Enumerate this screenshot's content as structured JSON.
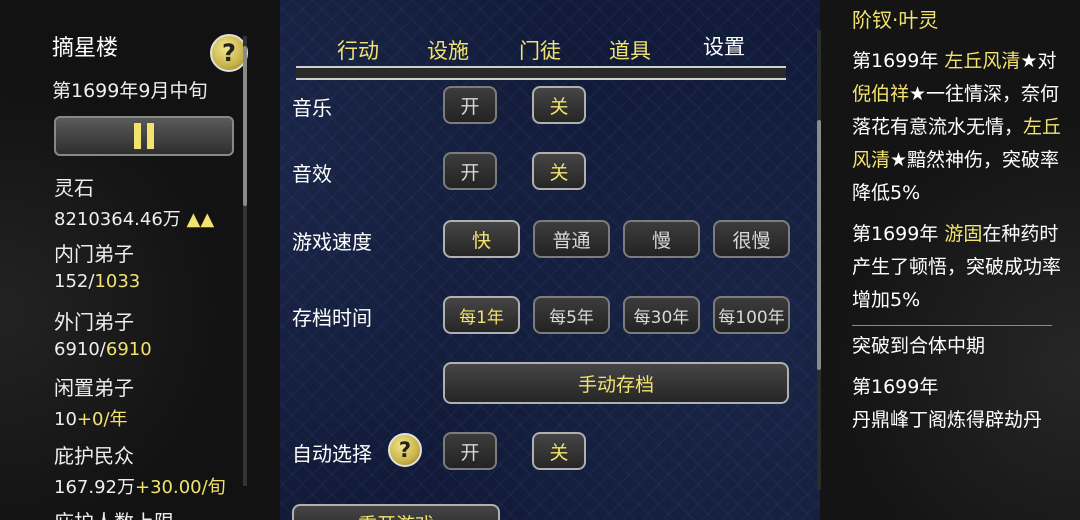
{
  "left": {
    "location": "摘星楼",
    "date": "第1699年9月中旬",
    "stats": [
      {
        "label": "灵石",
        "value": "8210364.46万",
        "suffix": "▲▲"
      },
      {
        "label": "内门弟子",
        "value": "152/",
        "value2": "1033"
      },
      {
        "label": "外门弟子",
        "value": "6910/",
        "value2": "6910"
      },
      {
        "label": "闲置弟子",
        "value": "10",
        "value2": "+0/年"
      },
      {
        "label": "庇护民众",
        "value": "167.92万",
        "value2": "+30.00/旬"
      },
      {
        "label": "庇护人数上限"
      }
    ]
  },
  "tabs": [
    "行动",
    "设施",
    "门徒",
    "道具",
    "设置"
  ],
  "active_tab": "设置",
  "settings": {
    "music": {
      "label": "音乐",
      "options": [
        "开",
        "关"
      ],
      "selected": "关"
    },
    "sfx": {
      "label": "音效",
      "options": [
        "开",
        "关"
      ],
      "selected": "关"
    },
    "speed": {
      "label": "游戏速度",
      "options": [
        "快",
        "普通",
        "慢",
        "很慢"
      ],
      "selected": "快"
    },
    "autosave": {
      "label": "存档时间",
      "options": [
        "每1年",
        "每5年",
        "每30年",
        "每100年"
      ],
      "selected": "每1年"
    },
    "manual_save": "手动存档",
    "auto_select": {
      "label": "自动选择",
      "options": [
        "开",
        "关"
      ],
      "selected": "关"
    },
    "restart": "重开游戏"
  },
  "log": {
    "title": "阶钗·叶灵",
    "e1_prefix": "第1699年 ",
    "e1_name1": "左丘风清",
    "e1_mid1": "★对",
    "e1_name2": "倪伯祥",
    "e1_mid2": "★一往情深，奈何落花有意流水无情，",
    "e1_name3": "左丘风清",
    "e1_end": "★黯然神伤，突破率降低5%",
    "e2_prefix": "第1699年 ",
    "e2_name": "游固",
    "e2_end": "在种药时产生了顿悟，突破成功率增加5%",
    "e3": "突破到合体中期",
    "e4_prefix": "第1699年",
    "e4_text": "丹鼎峰丁阁炼得辟劫丹"
  },
  "colors": {
    "accent": "#f2e36e",
    "background": "#111a38"
  }
}
